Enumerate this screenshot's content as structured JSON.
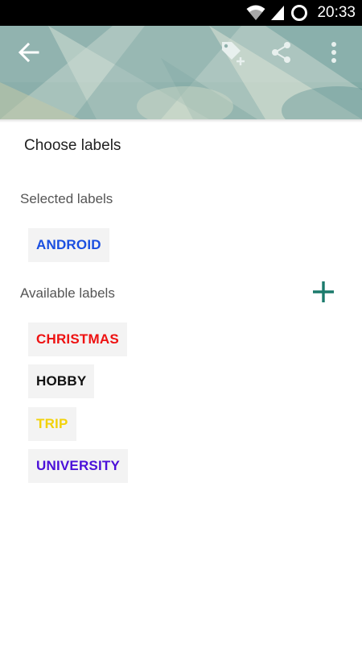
{
  "status_bar": {
    "time": "20:33",
    "icons": [
      "wifi-icon",
      "signal-icon",
      "sync-icon"
    ]
  },
  "toolbar": {
    "back_icon": "arrow-back-icon",
    "actions": [
      "add-label-icon",
      "share-icon",
      "more-vert-icon"
    ]
  },
  "dialog": {
    "title": "Choose labels",
    "selected_heading": "Selected labels",
    "available_heading": "Available labels",
    "add_icon": "plus-icon",
    "selected_labels": [
      {
        "text": "ANDROID",
        "color": "#1a4fe0"
      }
    ],
    "available_labels": [
      {
        "text": "CHRISTMAS",
        "color": "#ee1111"
      },
      {
        "text": "HOBBY",
        "color": "#111111"
      },
      {
        "text": "TRIP",
        "color": "#f2d20a"
      },
      {
        "text": "UNIVERSITY",
        "color": "#4b10d9"
      }
    ]
  },
  "colors": {
    "accent": "#1b7a6c",
    "chip_background": "#f3f3f3"
  }
}
